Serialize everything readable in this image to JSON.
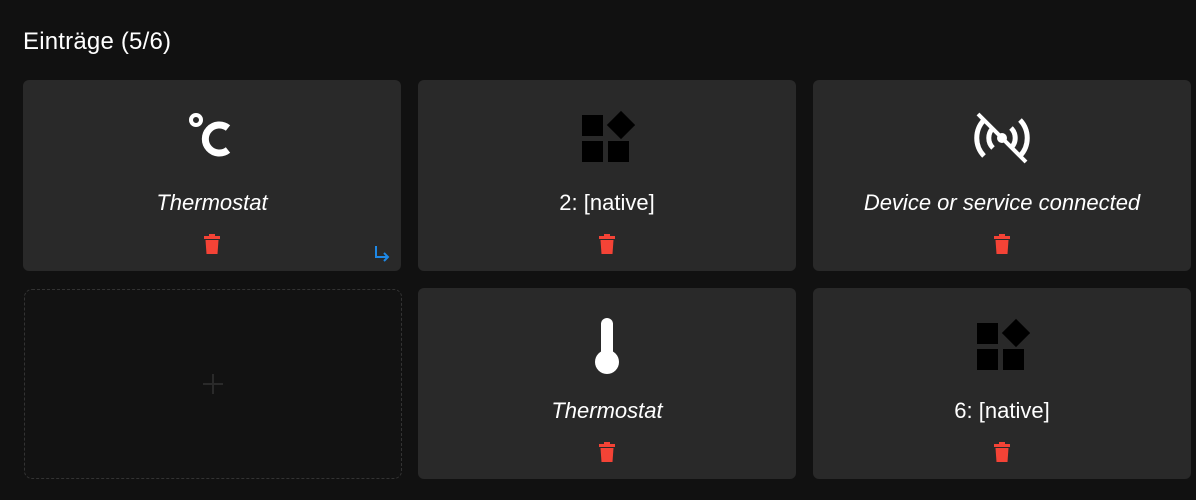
{
  "header": {
    "title": "Einträge (5/6)"
  },
  "colors": {
    "background": "#111111",
    "card": "#292929",
    "delete": "#f44336",
    "link": "#1e88e5",
    "icon": "#ffffff",
    "icon_dark": "#000000"
  },
  "cards": [
    {
      "label": "Thermostat",
      "icon": "celsius-icon",
      "italic": true,
      "has_link": true
    },
    {
      "label": "2: [native]",
      "icon": "shapes-icon",
      "italic": false
    },
    {
      "label": "Device or service connected",
      "icon": "wifi-off-icon",
      "italic": true
    },
    {
      "label": "Thermostat",
      "icon": "thermometer-icon",
      "italic": true
    },
    {
      "label": "6: [native]",
      "icon": "shapes-icon",
      "italic": false
    }
  ],
  "add_slot": {
    "icon": "plus-icon"
  }
}
